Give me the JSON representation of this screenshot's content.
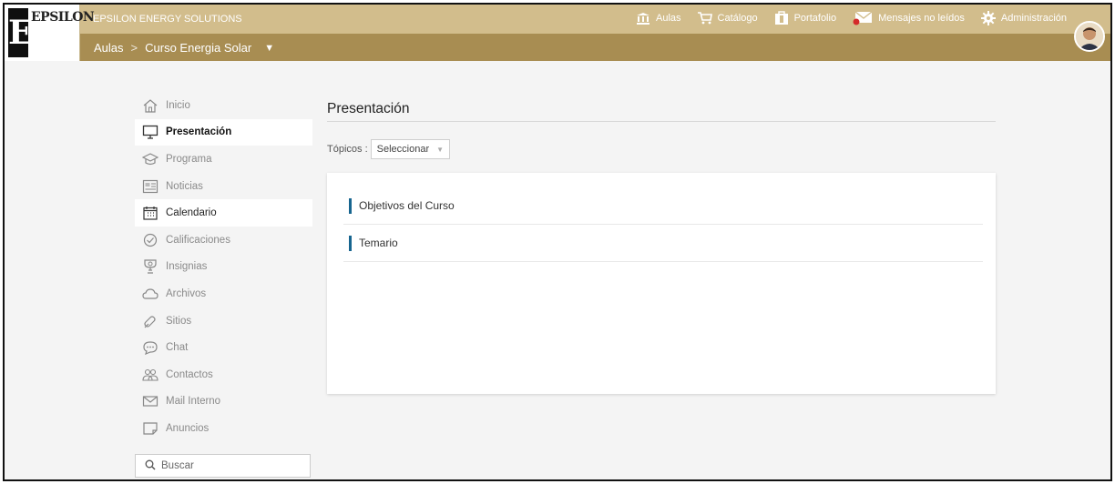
{
  "brand": {
    "logo_text": "EPSILON",
    "company": "EPSILON ENERGY SOLUTIONS"
  },
  "breadcrumb": {
    "root": "Aulas",
    "separator": ">",
    "current": "Curso Energia Solar"
  },
  "topnav": [
    {
      "label": "Aulas",
      "icon": "classroom-icon"
    },
    {
      "label": "Catálogo",
      "icon": "cart-icon"
    },
    {
      "label": "Portafolio",
      "icon": "briefcase-icon"
    },
    {
      "label": "Mensajes no leídos",
      "icon": "mail-icon"
    },
    {
      "label": "Administración",
      "icon": "gear-icon"
    }
  ],
  "sidebar": {
    "items": [
      {
        "label": "Inicio",
        "icon": "home-icon"
      },
      {
        "label": "Presentación",
        "icon": "monitor-icon"
      },
      {
        "label": "Programa",
        "icon": "graduation-cap-icon"
      },
      {
        "label": "Noticias",
        "icon": "newspaper-icon"
      },
      {
        "label": "Calendario",
        "icon": "calendar-icon"
      },
      {
        "label": "Calificaciones",
        "icon": "check-circle-icon"
      },
      {
        "label": "Insignias",
        "icon": "badge-icon"
      },
      {
        "label": "Archivos",
        "icon": "cloud-icon"
      },
      {
        "label": "Sitios",
        "icon": "link-icon"
      },
      {
        "label": "Chat",
        "icon": "chat-icon"
      },
      {
        "label": "Contactos",
        "icon": "contacts-icon"
      },
      {
        "label": "Mail Interno",
        "icon": "envelope-icon"
      },
      {
        "label": "Anuncios",
        "icon": "announcement-icon"
      }
    ],
    "search_placeholder": "Buscar"
  },
  "main": {
    "title": "Presentación",
    "topics_label": "Tópicos :",
    "topics_select": "Seleccionar",
    "sections": [
      "Objetivos del Curso",
      "Temario"
    ]
  },
  "colors": {
    "header": "#d2bd8c",
    "subheader": "#a88d52",
    "accent": "#17658f"
  }
}
